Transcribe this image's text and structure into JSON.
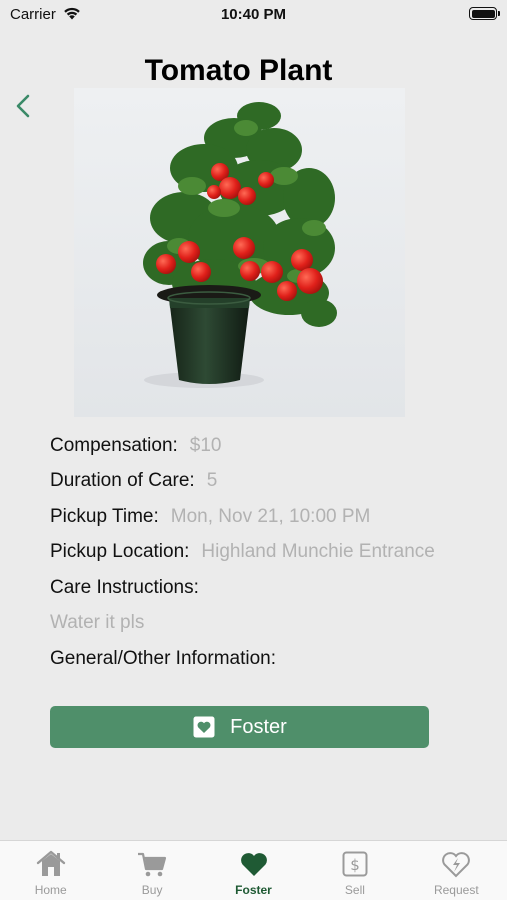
{
  "status_bar": {
    "carrier": "Carrier",
    "time": "10:40 PM"
  },
  "page": {
    "title": "Tomato Plant"
  },
  "details": [
    {
      "label": "Compensation:",
      "value": "$10"
    },
    {
      "label": "Duration of Care:",
      "value": "5"
    },
    {
      "label": "Pickup Time:",
      "value": "Mon, Nov 21, 10:00 PM"
    },
    {
      "label": "Pickup Location:",
      "value": "Highland Munchie Entrance"
    },
    {
      "label": "Care Instructions:",
      "value": ""
    },
    {
      "label": "",
      "value": "Water it pls"
    },
    {
      "label": "General/Other Information:",
      "value": ""
    }
  ],
  "action": {
    "label": "Foster",
    "icon": "heart-square-icon"
  },
  "tabs": [
    {
      "label": "Home",
      "icon": "house-icon",
      "active": false
    },
    {
      "label": "Buy",
      "icon": "cart-icon",
      "active": false
    },
    {
      "label": "Foster",
      "icon": "heart-icon",
      "active": true
    },
    {
      "label": "Sell",
      "icon": "dollar-square-icon",
      "active": false
    },
    {
      "label": "Request",
      "icon": "heart-bolt-icon",
      "active": false
    }
  ],
  "colors": {
    "accent": "#4f8f6a",
    "active_tab": "#1f5a34",
    "back": "#3a8a68",
    "muted_text": "#b2b2b2"
  }
}
